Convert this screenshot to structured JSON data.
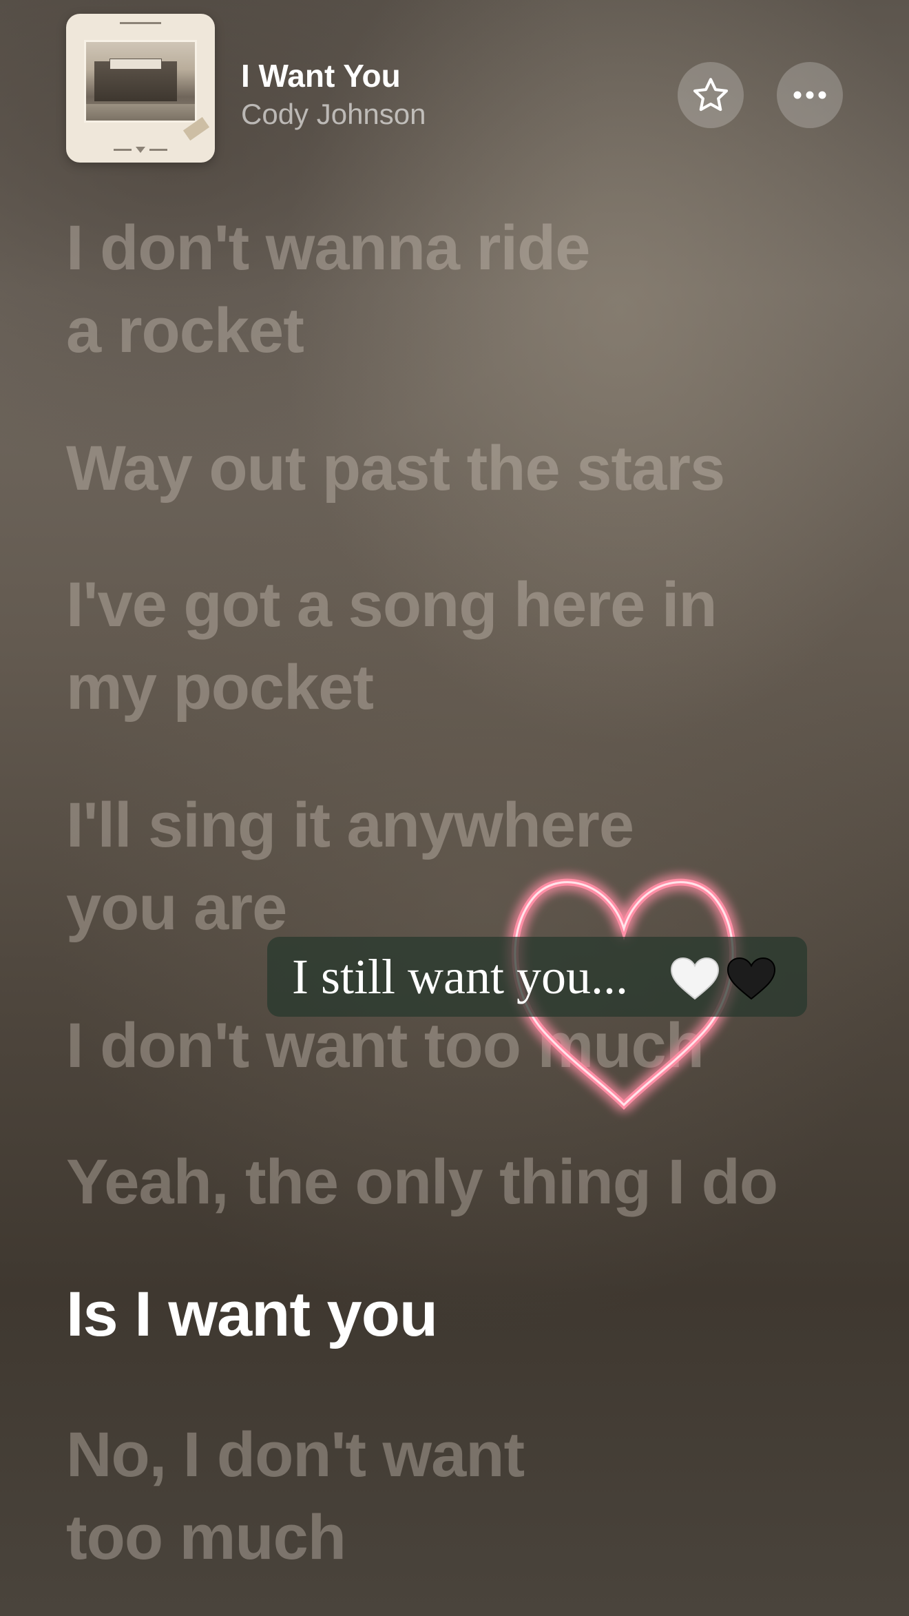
{
  "now_playing": {
    "title": "I Want You",
    "artist": "Cody Johnson",
    "artwork_icon": "album-artwork"
  },
  "header_actions": {
    "favorite_icon": "star-icon",
    "more_icon": "ellipsis-icon"
  },
  "lyrics": [
    {
      "line1": "I don't wanna ride",
      "line2": "a rocket",
      "active": false
    },
    {
      "line1": "Way out past the stars",
      "line2": "",
      "active": false
    },
    {
      "line1": "I've got a song here in",
      "line2": "my pocket",
      "active": false
    },
    {
      "line1": "I'll sing it anywhere",
      "line2": "you are",
      "active": false
    },
    {
      "line1": "I don't want too much",
      "line2": "",
      "active": false
    },
    {
      "line1": "Yeah, the only thing I do",
      "line2": "",
      "active": false
    },
    {
      "line1": "Is I want you",
      "line2": "",
      "active": true
    },
    {
      "line1": "No, I don't want",
      "line2": "too much",
      "active": false
    }
  ],
  "sticker": {
    "caption": "I still want you...",
    "emojis": [
      "white-heart-emoji",
      "black-heart-emoji"
    ],
    "neon_heart_color": "#ff8fa6"
  }
}
